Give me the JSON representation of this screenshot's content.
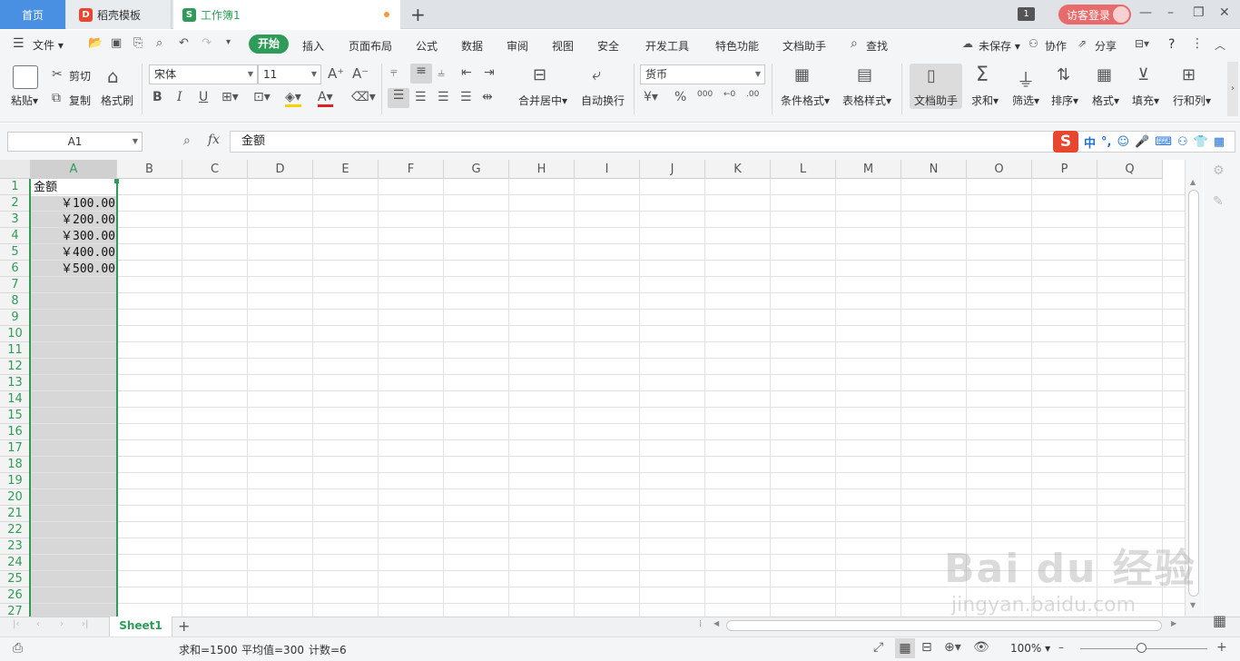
{
  "tabs": {
    "home": "首页",
    "templates": "稻壳模板",
    "workbook": "工作簿1",
    "new_tab": "+",
    "page_count": "1",
    "login": "访客登录"
  },
  "menu": {
    "file": "文件",
    "items": [
      "开始",
      "插入",
      "页面布局",
      "公式",
      "数据",
      "审阅",
      "视图",
      "安全",
      "开发工具",
      "特色功能",
      "文档助手",
      "查找"
    ],
    "unsaved": "未保存",
    "collab": "协作",
    "share": "分享",
    "help": "?"
  },
  "ribbon": {
    "paste": "粘贴",
    "cut": "剪切",
    "copy": "复制",
    "format_painter": "格式刷",
    "font_name": "宋体",
    "font_size": "11",
    "merge_center": "合并居中",
    "wrap_text": "自动换行",
    "number_format": "货币",
    "conditional_format": "条件格式",
    "table_style": "表格样式",
    "doc_assistant": "文档助手",
    "sum": "求和",
    "filter": "筛选",
    "sort": "排序",
    "format": "格式",
    "fill": "填充",
    "rows_cols": "行和列"
  },
  "formula_bar": {
    "name_box": "A1",
    "fx": "fx",
    "value": "金额"
  },
  "ime": {
    "logo": "S",
    "chinese": "中"
  },
  "columns": [
    "A",
    "B",
    "C",
    "D",
    "E",
    "F",
    "G",
    "H",
    "I",
    "J",
    "K",
    "L",
    "M",
    "N",
    "O",
    "P",
    "Q"
  ],
  "rows": [
    "1",
    "2",
    "3",
    "4",
    "5",
    "6",
    "7",
    "8",
    "9",
    "10",
    "11",
    "12",
    "13",
    "14",
    "15",
    "16",
    "17",
    "18",
    "19",
    "20",
    "21",
    "22",
    "23",
    "24",
    "25",
    "26",
    "27"
  ],
  "cells": {
    "A1": "金额",
    "A2": "￥100.00",
    "A3": "￥200.00",
    "A4": "￥300.00",
    "A5": "￥400.00",
    "A6": "￥500.00"
  },
  "sheet": {
    "name": "Sheet1",
    "add": "+"
  },
  "status": {
    "sum": "求和=1500",
    "average": "平均值=300",
    "count": "计数=6",
    "zoom": "100%"
  },
  "watermark": {
    "brand": "Bai du 经验",
    "url": "jingyan.baidu.com"
  },
  "colors": {
    "accent_green": "#2e9c58",
    "home_tab_blue": "#4a90e2",
    "login_red": "#e86b6b"
  }
}
